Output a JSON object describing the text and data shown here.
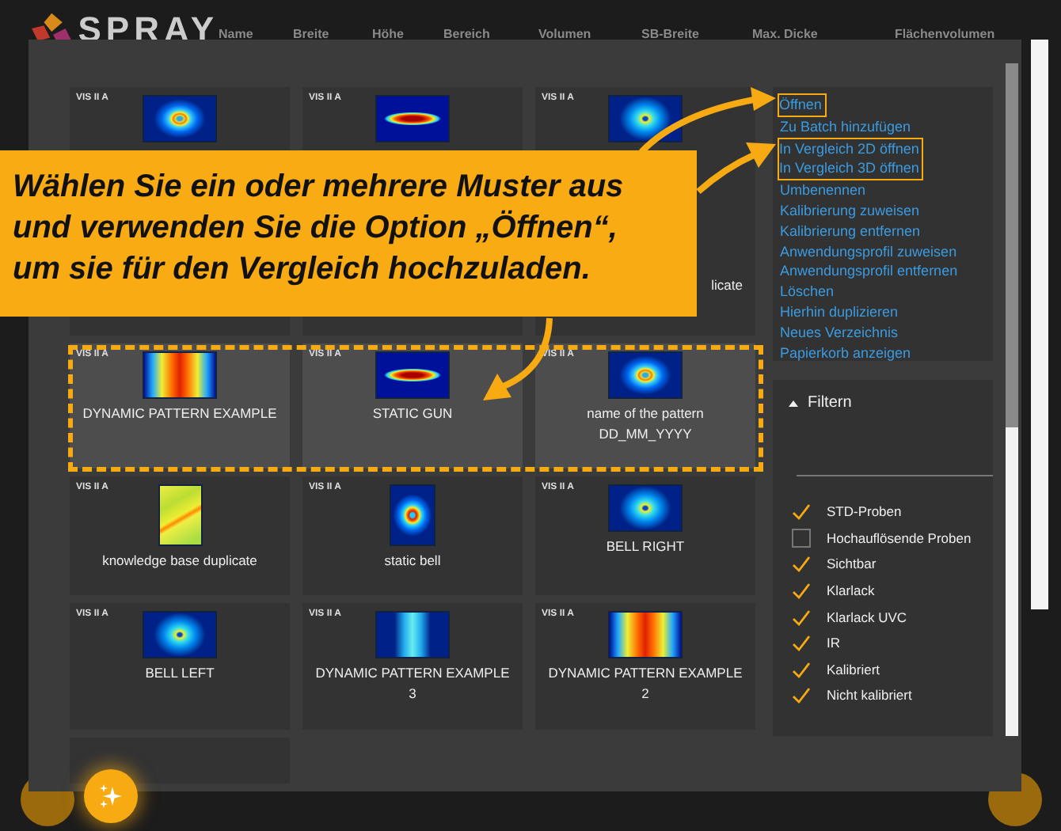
{
  "app": {
    "logo": "SPRAY",
    "columns": [
      "Name",
      "Breite",
      "Höhe",
      "Bereich",
      "Volumen",
      "SB-Breite",
      "Max. Dicke",
      "Flächenvolumen"
    ]
  },
  "dialog": {
    "cards": [
      {
        "tag": "VIS II A",
        "kind": "ring",
        "selected": false
      },
      {
        "tag": "VIS II A",
        "kind": "ellipse",
        "selected": false
      },
      {
        "tag": "VIS II A",
        "kind": "spot",
        "label": "licate",
        "label_covered": true,
        "selected": false
      },
      {
        "tag": "VIS II A",
        "kind": "band",
        "label": "DYNAMIC PATTERN EXAMPLE",
        "label_covered": false,
        "selected": true
      },
      {
        "tag": "VIS II A",
        "kind": "ellipse",
        "label": "STATIC GUN",
        "label_covered": false,
        "selected": true
      },
      {
        "tag": "VIS II A",
        "kind": "ring",
        "label": "name of the pattern\nDD_MM_YYYY",
        "label_covered": false,
        "selected": true
      },
      {
        "tag": "VIS II A",
        "kind": "map",
        "label": "knowledge base duplicate",
        "label_covered": false,
        "selected": false
      },
      {
        "tag": "VIS II A",
        "kind": "bell",
        "label": "static bell",
        "label_covered": false,
        "selected": false
      },
      {
        "tag": "VIS II A",
        "kind": "spot",
        "label": "BELL RIGHT",
        "label_covered": false,
        "selected": false
      },
      {
        "tag": "VIS II A",
        "kind": "spot",
        "label": "BELL LEFT",
        "label_covered": false,
        "selected": false
      },
      {
        "tag": "VIS II A",
        "kind": "stripe",
        "label": "DYNAMIC PATTERN EXAMPLE\n3",
        "label_covered": false,
        "selected": false
      },
      {
        "tag": "VIS II A",
        "kind": "band",
        "label": "DYNAMIC PATTERN EXAMPLE\n2",
        "label_covered": false,
        "selected": false
      },
      {
        "kind": "none",
        "selected": false
      }
    ],
    "menu": [
      {
        "kind": "framed",
        "items": [
          "Öffnen"
        ]
      },
      {
        "kind": "plain",
        "items": [
          "Zu Batch hinzufügen"
        ]
      },
      {
        "kind": "framed",
        "items": [
          "In Vergleich 2D öffnen",
          "In Vergleich 3D öffnen"
        ]
      },
      {
        "kind": "plain",
        "items": [
          "Umbenennen",
          "Kalibrierung zuweisen",
          "Kalibrierung entfernen",
          "Anwendungsprofil zuweisen",
          "Anwendungsprofil entfernen",
          "Löschen",
          "Hierhin duplizieren",
          "Neues Verzeichnis",
          "Papierkorb anzeigen"
        ]
      }
    ],
    "filter": {
      "title": "Filtern",
      "expanded": true,
      "options": [
        {
          "label": "STD-Proben",
          "checked": true
        },
        {
          "label": "Hochauflösende Proben",
          "checked": false
        },
        {
          "label": "Sichtbar",
          "checked": true
        },
        {
          "label": "Klarlack",
          "checked": true
        },
        {
          "label": "Klarlack UVC",
          "checked": true
        },
        {
          "label": "IR",
          "checked": true
        },
        {
          "label": "Kalibriert",
          "checked": true
        },
        {
          "label": "Nicht kalibriert",
          "checked": true
        }
      ]
    }
  },
  "callout": {
    "text": "Wählen Sie ein oder mehrere Muster aus\nund verwenden Sie die Option „Öffnen“,\num sie für den Vergleich hochzuladen."
  }
}
